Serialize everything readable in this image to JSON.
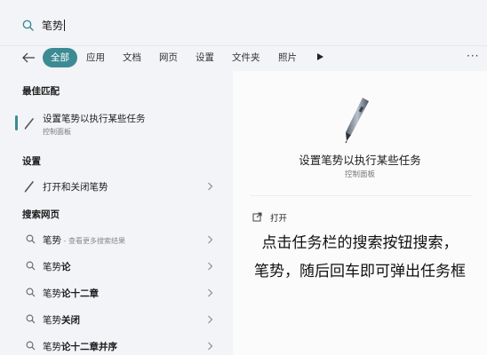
{
  "search": {
    "query": "笔势"
  },
  "filters": {
    "tabs": [
      {
        "label": "全部",
        "active": true
      },
      {
        "label": "应用"
      },
      {
        "label": "文档"
      },
      {
        "label": "网页"
      },
      {
        "label": "设置"
      },
      {
        "label": "文件夹"
      },
      {
        "label": "照片"
      }
    ],
    "more_label": "···"
  },
  "best_match": {
    "heading": "最佳匹配",
    "title": "设置笔势以执行某些任务",
    "subtitle": "控制面板"
  },
  "settings": {
    "heading": "设置",
    "items": [
      {
        "label": "打开和关闭笔势"
      }
    ]
  },
  "web": {
    "heading": "搜索网页",
    "items": [
      {
        "query": "笔势",
        "suffix": "",
        "hint": " - 查看更多搜索结果"
      },
      {
        "query": "笔势",
        "suffix": "论",
        "hint": ""
      },
      {
        "query": "笔势",
        "suffix": "论十二章",
        "hint": ""
      },
      {
        "query": "笔势",
        "suffix": "关闭",
        "hint": ""
      },
      {
        "query": "笔势",
        "suffix": "论十二章并序",
        "hint": ""
      }
    ]
  },
  "detail": {
    "title": "设置笔势以执行某些任务",
    "subtitle": "控制面板",
    "open_label": "打开"
  },
  "caption": {
    "line1": "点击任务栏的搜索按钮搜索，",
    "line2": "笔势，随后回车即可弹出任务框"
  },
  "colors": {
    "accent": "#3c8b94",
    "background": "#f3f4f7",
    "detail_background": "#fbfbfc"
  }
}
